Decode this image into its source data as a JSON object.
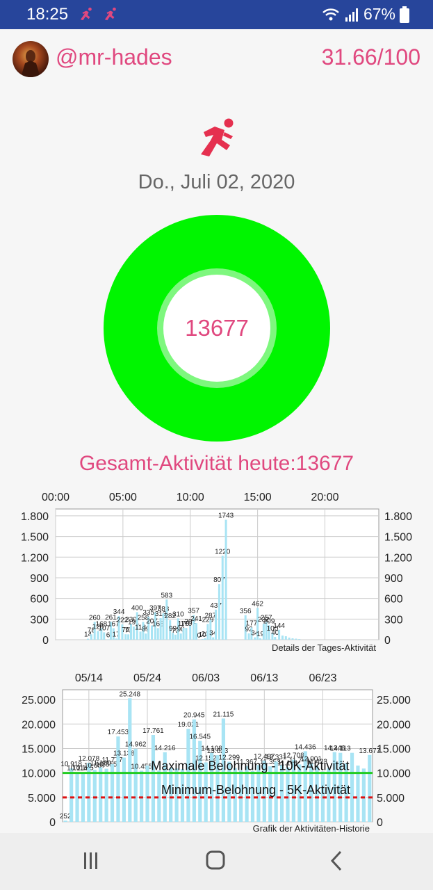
{
  "status_bar": {
    "time": "18:25",
    "battery": "67%"
  },
  "header": {
    "username": "@mr-hades",
    "score": "31.66/100"
  },
  "date": "Do., Juli 02, 2020",
  "ring": {
    "value": "13677",
    "progress": 1.0
  },
  "total_label": "Gesamt-Aktivität heute:13677",
  "colors": {
    "accent": "#e0487f",
    "status_bar": "#27459b",
    "ring": "#00f500",
    "bars": "#a8e4f4",
    "max_line": "#22cc22",
    "min_line": "#dd1111"
  },
  "chart_data": [
    {
      "type": "bar",
      "caption": "Details der Tages-Aktivität",
      "x_ticks": [
        "00:00",
        "05:00",
        "10:00",
        "15:00",
        "20:00"
      ],
      "x_tick_hours": [
        0,
        5,
        10,
        15,
        20
      ],
      "xlim_hours": [
        0,
        24
      ],
      "ylim": [
        0,
        1900
      ],
      "y_ticks": [
        0,
        300,
        600,
        900,
        1200,
        1500,
        1800
      ],
      "y_tick_labels": [
        "0",
        "300",
        "600",
        "900",
        "1.200",
        "1.500",
        "1.800"
      ],
      "x_hours": [
        2.4,
        2.65,
        2.9,
        3.15,
        3.4,
        3.6,
        3.9,
        4.1,
        4.3,
        4.5,
        4.7,
        4.95,
        5.2,
        5.4,
        5.6,
        5.8,
        6.05,
        6.3,
        6.5,
        6.7,
        6.9,
        7.15,
        7.4,
        7.6,
        7.8,
        8.0,
        8.25,
        8.5,
        8.7,
        8.9,
        9.1,
        9.3,
        9.5,
        9.7,
        10.0,
        10.25,
        10.45,
        10.65,
        10.9,
        11.1,
        11.3,
        11.5,
        11.7,
        11.9,
        12.15,
        12.4,
        12.65,
        14.1,
        14.35,
        14.55,
        14.8,
        15.0,
        15.2,
        15.45,
        15.65,
        15.85,
        16.1,
        16.3,
        16.6,
        16.85,
        17.1,
        17.35,
        17.6,
        17.85,
        18.1
      ],
      "values": [
        14,
        78,
        260,
        126,
        168,
        107,
        6,
        261,
        167,
        17,
        344,
        222,
        79,
        77,
        230,
        191,
        400,
        118,
        258,
        89,
        335,
        207,
        397,
        168,
        313,
        383,
        583,
        282,
        99,
        73,
        310,
        90,
        170,
        170,
        202,
        357,
        241,
        0,
        10,
        21,
        229,
        287,
        34,
        437,
        807,
        1220,
        1743,
        356,
        92,
        177,
        34,
        462,
        19,
        232,
        257,
        209,
        100,
        40,
        144,
        60,
        50,
        30,
        20,
        15,
        10
      ],
      "labels": [
        "14",
        "78",
        "260",
        "126",
        "168",
        "107",
        "6",
        "261",
        "167",
        "17",
        "344",
        "222",
        "79",
        "77",
        "230",
        "191",
        "400",
        "118",
        "258",
        "89",
        "335",
        "207",
        "397",
        "168",
        "313",
        "383",
        "583",
        "282",
        "99",
        "73",
        "310",
        "90",
        "170",
        "170",
        "202",
        "357",
        "241",
        "0",
        "10",
        "21",
        "229",
        "287",
        "34",
        "437",
        "807",
        "1220",
        "1743",
        "356",
        "92",
        "177",
        "34",
        "462",
        "19",
        "232",
        "257",
        "209",
        "100",
        "40",
        "144",
        "",
        "",
        "",
        "",
        "",
        ""
      ]
    },
    {
      "type": "bar",
      "caption": "Grafik der Aktivitäten-Historie",
      "x_ticks": [
        "05/14",
        "05/24",
        "06/03",
        "06/13",
        "06/23"
      ],
      "x_tick_days": [
        4,
        14,
        24,
        34,
        44
      ],
      "first_day": "05/10",
      "ylim": [
        0,
        27000
      ],
      "y_ticks": [
        0,
        5000,
        10000,
        15000,
        20000,
        25000
      ],
      "y_tick_labels": [
        "0",
        "5.000",
        "10.000",
        "15.000",
        "20.000",
        "25.000"
      ],
      "max_line": {
        "value": 10000,
        "label": "Maximale Belohnung - 10K-Aktivität"
      },
      "min_line": {
        "value": 5000,
        "label": "Minimum-Belohnung - 5K-Aktivität"
      },
      "values": [
        252,
        10918,
        10114,
        10145,
        12078,
        10657,
        11160,
        10855,
        11777,
        17453,
        13138,
        25248,
        14962,
        10455,
        11500,
        17761,
        10500,
        14216,
        11000,
        10900,
        10800,
        19021,
        20945,
        16545,
        12152,
        14108,
        13623,
        21115,
        12299,
        11000,
        10500,
        11367,
        10400,
        11600,
        12497,
        11353,
        12331,
        11600,
        11141,
        12708,
        11741,
        14436,
        12001,
        11423,
        10300,
        11000,
        14246,
        14113,
        12000,
        14113,
        11500,
        10900,
        13677
      ],
      "labels": [
        "252",
        "10.918",
        "10.114",
        "10.145",
        "12.078",
        "10.657",
        "11.160",
        "10.855",
        "11.777",
        "17.453",
        "13.138",
        "25.248",
        "14.962",
        "10.455",
        "",
        "17.761",
        "",
        "14.216",
        "",
        "",
        "",
        "19.021",
        "20.945",
        "16.545",
        "12.152",
        "14.108",
        "13.623",
        "21.115",
        "12.299",
        "",
        "",
        "11.367",
        "",
        "",
        "12.497",
        "11.353",
        "12.331",
        "",
        "11.141",
        "12.708",
        "11.741",
        "14.436",
        "12.001",
        "11.423",
        "",
        "",
        "14.246",
        "14.113",
        "",
        "",
        "",
        "",
        "13.677"
      ]
    }
  ]
}
